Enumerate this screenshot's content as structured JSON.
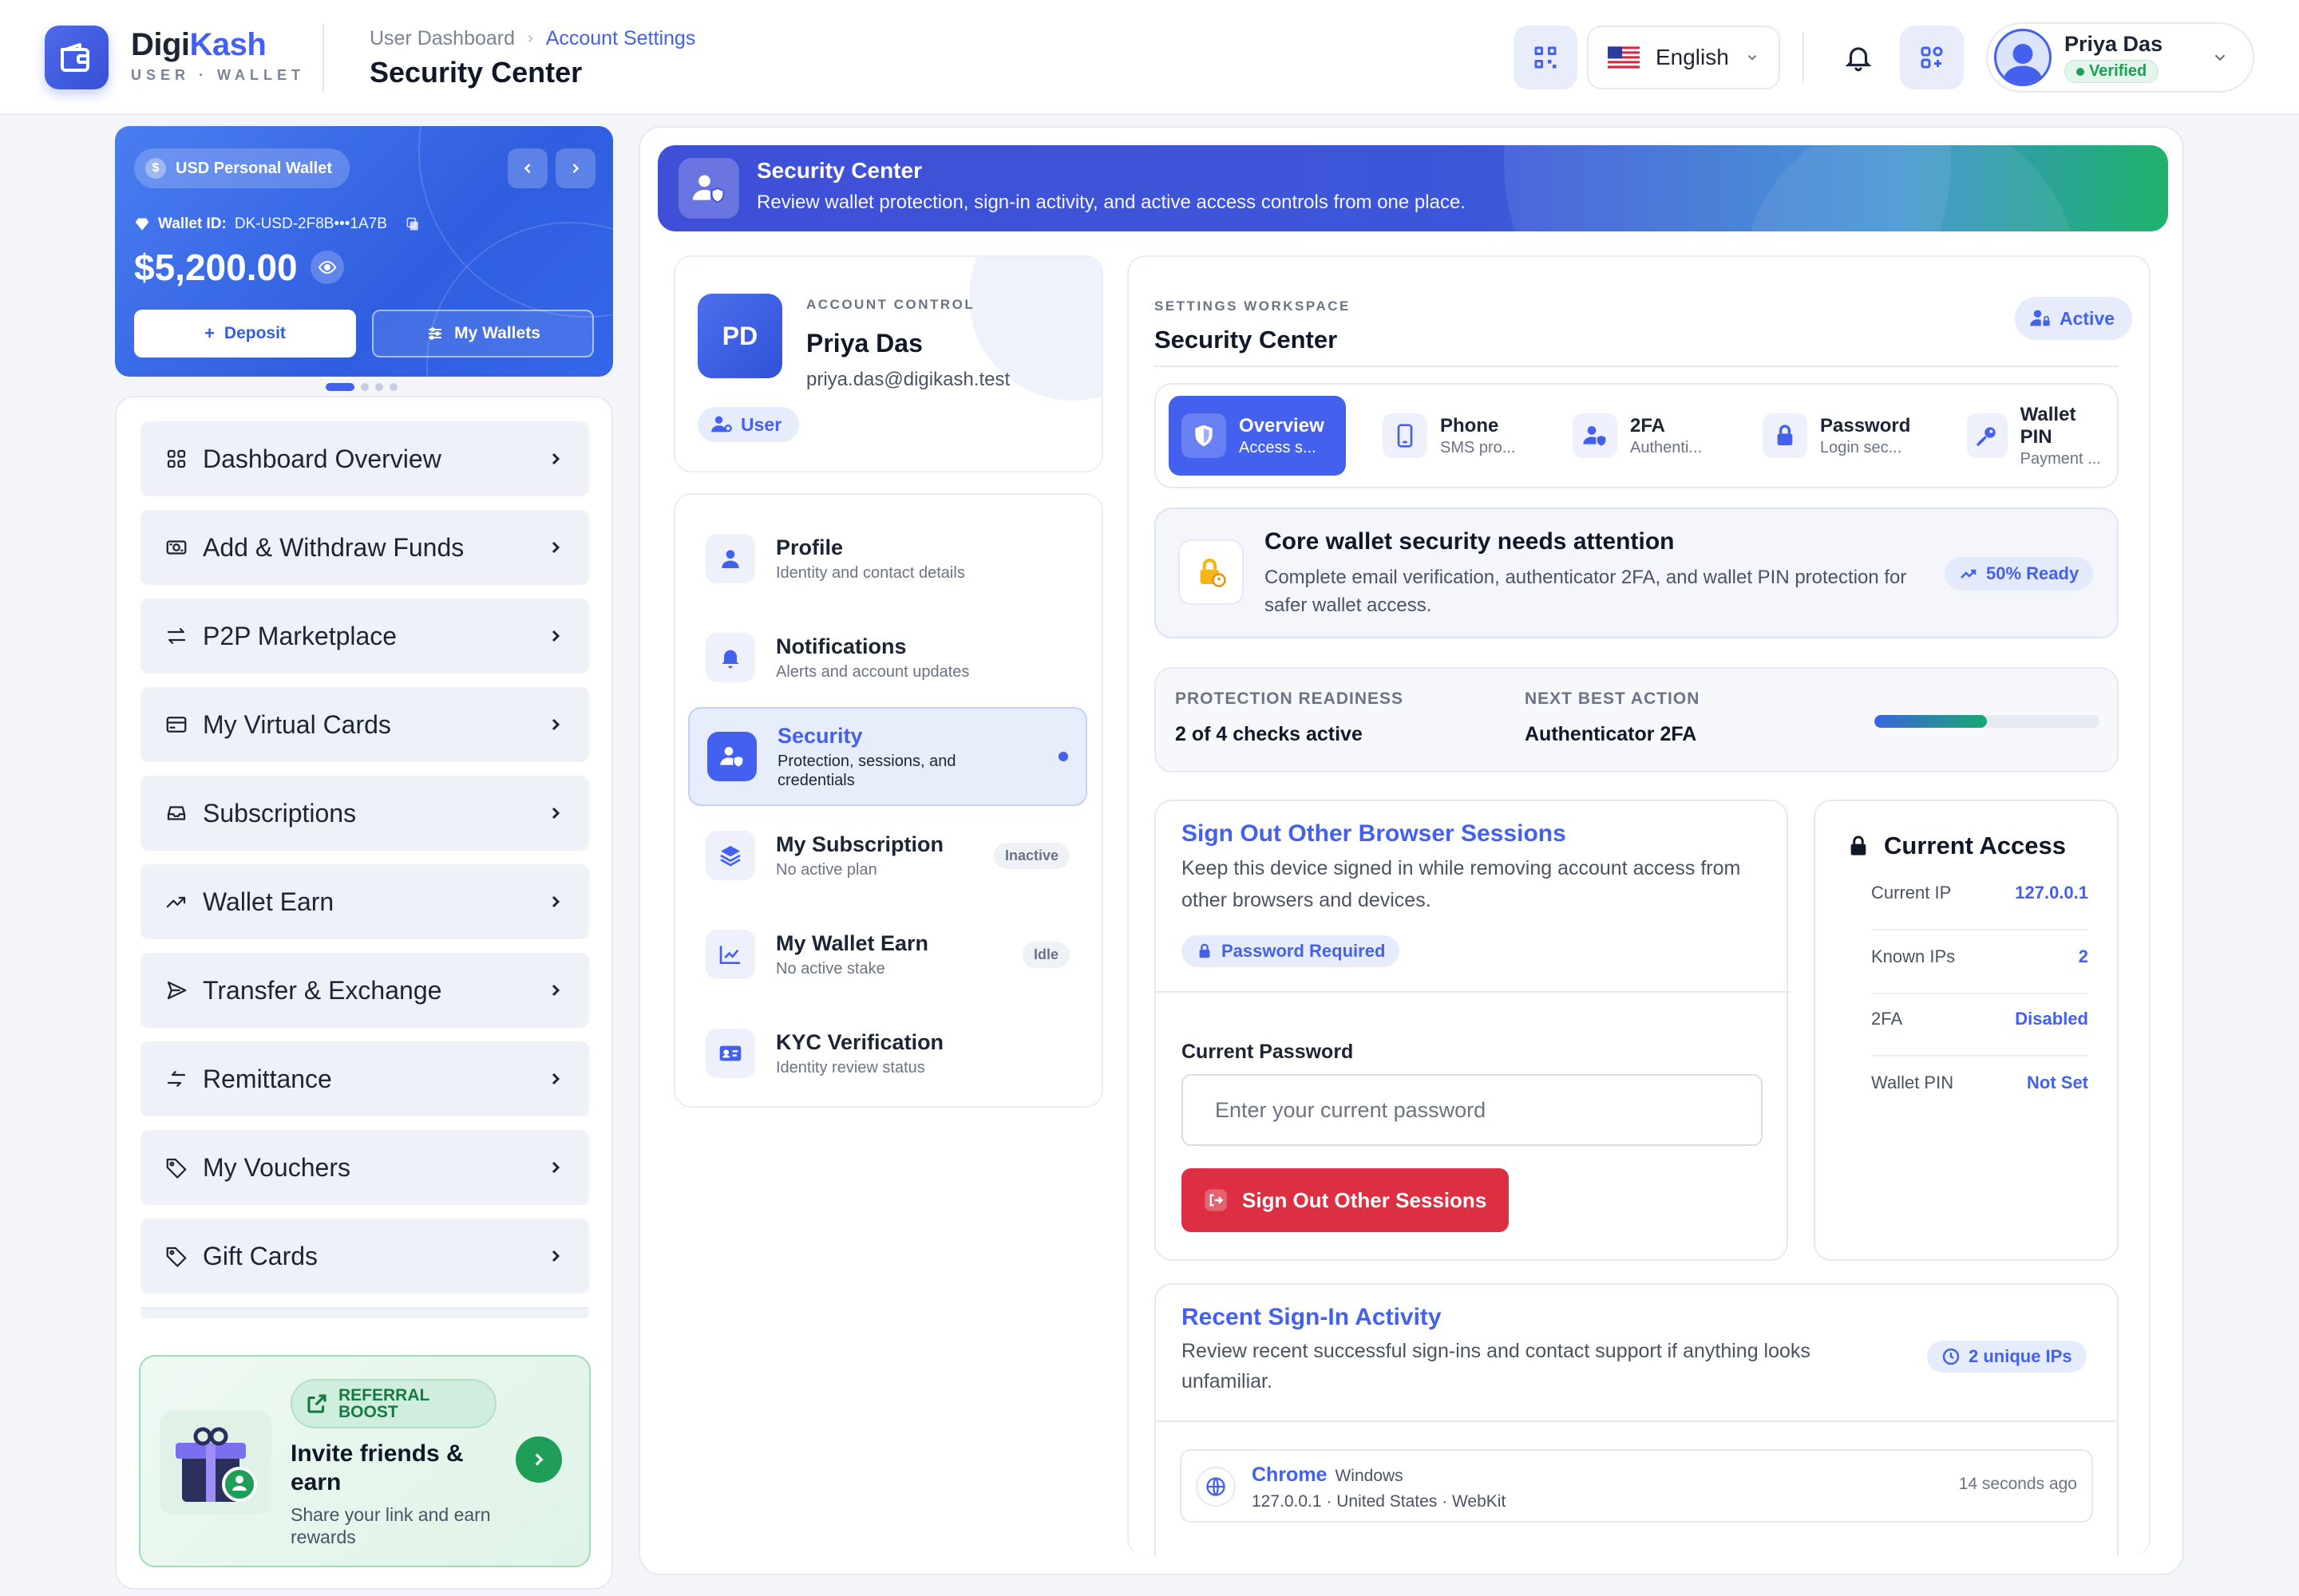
{
  "brand": {
    "name_a": "Digi",
    "name_b": "Kash",
    "sub": "USER · WALLET"
  },
  "header": {
    "breadcrumb": [
      "User Dashboard",
      "Account Settings"
    ],
    "title": "Security Center",
    "language": "English",
    "user_name": "Priya Das",
    "user_status": "Verified"
  },
  "wallet": {
    "name": "USD Personal Wallet",
    "id_label": "Wallet ID:",
    "id_value": "DK-USD-2F8B•••1A7B",
    "balance": "$5,200.00",
    "deposit": "Deposit",
    "my_wallets": "My Wallets"
  },
  "nav": [
    {
      "label": "Dashboard Overview",
      "icon": "grid-icon"
    },
    {
      "label": "Add & Withdraw Funds",
      "icon": "cash-icon"
    },
    {
      "label": "P2P Marketplace",
      "icon": "swap-icon"
    },
    {
      "label": "My Virtual Cards",
      "icon": "card-icon"
    },
    {
      "label": "Subscriptions",
      "icon": "inbox-icon"
    },
    {
      "label": "Wallet Earn",
      "icon": "trend-icon"
    },
    {
      "label": "Transfer & Exchange",
      "icon": "send-icon"
    },
    {
      "label": "Remittance",
      "icon": "exchange-icon"
    },
    {
      "label": "My Vouchers",
      "icon": "tag-icon"
    },
    {
      "label": "Gift Cards",
      "icon": "tag-icon"
    }
  ],
  "referral": {
    "badge": "REFERRAL BOOST",
    "title": "Invite friends & earn",
    "desc": "Share your link and earn rewards"
  },
  "banner": {
    "title": "Security Center",
    "desc": "Review wallet protection, sign-in activity, and active access controls from one place."
  },
  "account": {
    "label": "ACCOUNT CONTROL",
    "initials": "PD",
    "name": "Priya Das",
    "email": "priya.das@digikash.test",
    "role": "User"
  },
  "menu": [
    {
      "title": "Profile",
      "sub": "Identity and contact details",
      "badge": ""
    },
    {
      "title": "Notifications",
      "sub": "Alerts and account updates",
      "badge": ""
    },
    {
      "title": "Security",
      "sub": "Protection, sessions, and credentials",
      "badge": ""
    },
    {
      "title": "My Subscription",
      "sub": "No active plan",
      "badge": "Inactive"
    },
    {
      "title": "My Wallet Earn",
      "sub": "No active stake",
      "badge": "Idle"
    },
    {
      "title": "KYC Verification",
      "sub": "Identity review status",
      "badge": ""
    }
  ],
  "workspace": {
    "label": "SETTINGS WORKSPACE",
    "title": "Security Center",
    "status": "Active"
  },
  "tabs": [
    {
      "title": "Overview",
      "sub": "Access s..."
    },
    {
      "title": "Phone",
      "sub": "SMS pro..."
    },
    {
      "title": "2FA",
      "sub": "Authenti..."
    },
    {
      "title": "Password",
      "sub": "Login sec..."
    },
    {
      "title": "Wallet PIN",
      "sub": "Payment ..."
    }
  ],
  "alert": {
    "title": "Core wallet security needs attention",
    "desc": "Complete email verification, authenticator 2FA, and wallet PIN protection for safer wallet access.",
    "ready": "50% Ready"
  },
  "readiness": {
    "label1": "PROTECTION READINESS",
    "value1": "2 of 4 checks active",
    "label2": "NEXT BEST ACTION",
    "value2": "Authenticator 2FA",
    "progress": 0.5
  },
  "signout": {
    "title": "Sign Out Other Browser Sessions",
    "desc": "Keep this device signed in while removing account access from other browsers and devices.",
    "badge": "Password Required",
    "field_label": "Current Password",
    "placeholder": "Enter your current password",
    "button": "Sign Out Other Sessions"
  },
  "access": {
    "title": "Current Access",
    "rows": [
      {
        "k": "Current IP",
        "v": "127.0.0.1"
      },
      {
        "k": "Known IPs",
        "v": "2"
      },
      {
        "k": "2FA",
        "v": "Disabled"
      },
      {
        "k": "Wallet PIN",
        "v": "Not Set"
      }
    ]
  },
  "recent": {
    "title": "Recent Sign-In Activity",
    "desc": "Review recent successful sign-ins and contact support if anything looks unfamiliar.",
    "badge": "2 unique IPs",
    "session": {
      "browser": "Chrome",
      "os": "Windows",
      "meta": "127.0.0.1 · United States · WebKit",
      "time": "14 seconds ago"
    }
  },
  "colors": {
    "accent": "#4361ee",
    "danger": "#dc2f42",
    "success": "#1e9e57"
  }
}
